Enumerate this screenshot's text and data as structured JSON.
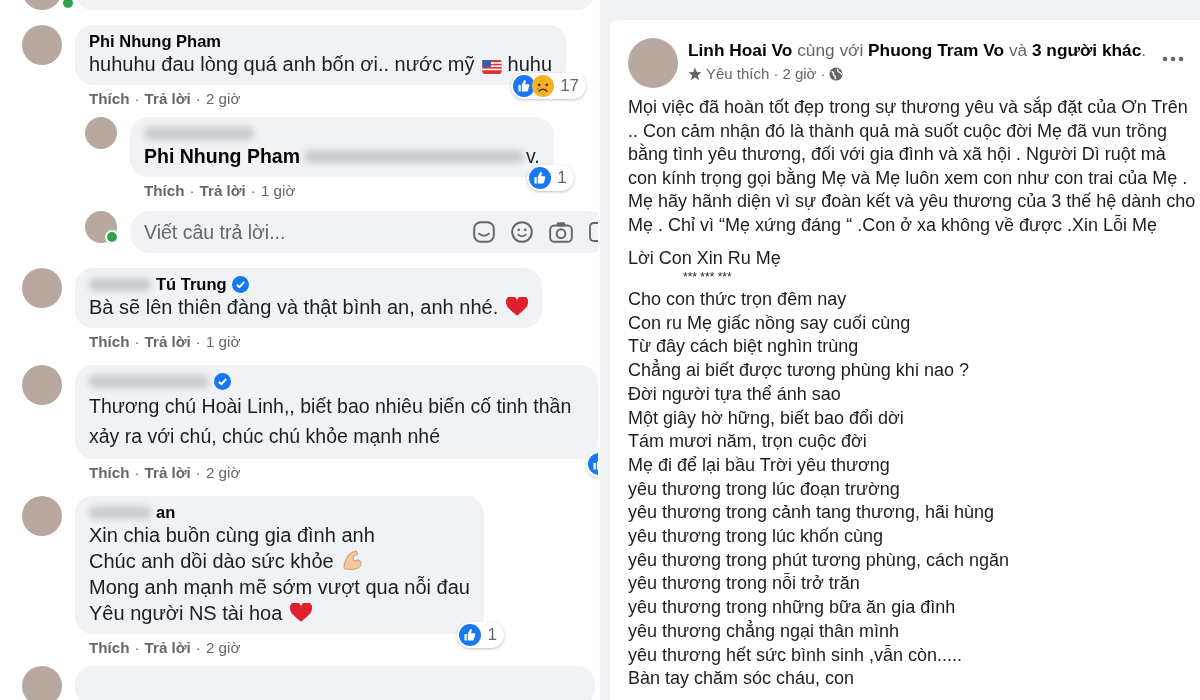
{
  "comments_panel": {
    "comments": [
      {
        "author": "Phi Nhung Pham",
        "author_blur_before": false,
        "verified": false,
        "online": false,
        "body": [
          [
            {
              "kind": "text",
              "text": "huhuhu đau lòng quá anh bốn ơi.. nước mỹ "
            },
            {
              "kind": "flag"
            },
            {
              "kind": "text",
              "text": " huhu"
            }
          ]
        ],
        "reactions": {
          "icons": [
            {
              "kind": "like"
            },
            {
              "kind": "sad"
            }
          ],
          "count": "17"
        },
        "actions": {
          "like": "Thích",
          "sep1": "·",
          "reply": "Trả lời",
          "sep2": "·",
          "time": "2 giờ"
        },
        "replies": [
          {
            "author_blurred": true,
            "mention": "Phi Nhung Pham",
            "mention_tail_blurred": true,
            "tail": "v.",
            "reactions": {
              "icons": [
                {
                  "kind": "like"
                }
              ],
              "count": "1"
            },
            "actions": {
              "like": "Thích",
              "sep1": "·",
              "reply": "Trả lời",
              "sep2": "·",
              "time": "1 giờ"
            }
          }
        ],
        "reply_box": {
          "placeholder": "Viết câu trả lời...",
          "online": true
        }
      },
      {
        "author": "Tú Trung",
        "author_blur_before": true,
        "verified": true,
        "online": false,
        "body": [
          [
            {
              "kind": "text",
              "text": "Bà sẽ lên thiên đàng và thật bình an, anh nhé. "
            },
            {
              "kind": "heart"
            }
          ]
        ],
        "actions": {
          "like": "Thích",
          "sep1": "·",
          "reply": "Trả lời",
          "sep2": "·",
          "time": "1 giờ"
        }
      },
      {
        "author_blur_before": true,
        "verified": true,
        "online": false,
        "body": [
          [
            {
              "kind": "text",
              "text": "Thương chú Hoài Linh,, biết bao nhiêu biến cố tinh thần xảy ra với chú, chúc chú khỏe mạnh nhé"
            }
          ]
        ],
        "reactions": {
          "icons": [
            {
              "kind": "like"
            }
          ]
        },
        "actions": {
          "like": "Thích",
          "sep1": "·",
          "reply": "Trả lời",
          "sep2": "·",
          "time": "2 giờ"
        }
      },
      {
        "author": "an",
        "author_blur_before": true,
        "verified": false,
        "online": false,
        "body": [
          [
            {
              "kind": "text",
              "text": "Xin chia buồn cùng gia đình anh"
            }
          ],
          [
            {
              "kind": "text",
              "text": "Chúc anh dồi dào sức khỏe "
            },
            {
              "kind": "arm"
            }
          ],
          [
            {
              "kind": "text",
              "text": "Mong anh mạnh mẽ sớm vượt qua nỗi đau"
            }
          ],
          [
            {
              "kind": "text",
              "text": "Yêu người NS tài hoa "
            },
            {
              "kind": "heart"
            }
          ]
        ],
        "reactions": {
          "icons": [
            {
              "kind": "like"
            }
          ],
          "count": "1"
        },
        "actions": {
          "like": "Thích",
          "sep1": "·",
          "reply": "Trả lời",
          "sep2": "·",
          "time": "2 giờ"
        }
      }
    ]
  },
  "post": {
    "author": "Linh Hoai Vo",
    "with_word": "cùng với",
    "tagged": "Phuong Tram Vo",
    "and_word": "và",
    "others": "3 người khác",
    "period": ".",
    "audience_label": "Yêu thích",
    "sep1": "·",
    "time": "2 giờ",
    "sep2": "·",
    "paragraph": "Mọi việc đã hoàn tốt đẹp trong sự thương yêu và sắp đặt của Ơn Trên .. Con cảm nhận đó là thành quả mà suốt cuộc đời Mẹ đã vun trồng bằng tình yêu thương, đối với gia đình và xã hội . Người Dì ruột mà con kính trọng gọi bằng Mẹ và Mẹ luôn xem con như con trai của Mẹ . Mẹ hãy hãnh diện vì sự đoàn kết và yêu thương của 3 thế hệ dành cho Mẹ . Chỉ vì “Mẹ xứng đáng “ .Con ở xa không về được .Xin Lỗi Mẹ",
    "poem_title": "Lời Con Xin Ru Mẹ",
    "separator": "*** *** ***",
    "poem_lines": [
      "Cho con thức trọn đêm nay",
      "Con ru Mẹ giấc nồng say cuối cùng",
      "Từ đây cách biệt nghìn trùng",
      "Chẳng ai biết được tương phùng khi nao ?",
      "Đời người tựa thể ánh sao",
      "Một giây hờ hững, biết bao đổi dời",
      "Tám mươi năm, trọn cuộc đời",
      "Mẹ đi để lại bầu Trời yêu thương",
      "yêu thương trong lúc đoạn trường",
      "yêu thương trong cảnh tang thương, hãi hùng",
      "yêu thương trong lúc khốn cùng",
      "yêu thương trong phút tương phùng, cách ngăn",
      "yêu thương trong nỗi trở trăn",
      "yêu thương trong những bữa ăn gia đình",
      "yêu thương chẳng ngại thân mình",
      "yêu thương hết sức bình sinh ,vẫn còn.....",
      "Bàn tay chăm sóc cháu, con"
    ]
  }
}
